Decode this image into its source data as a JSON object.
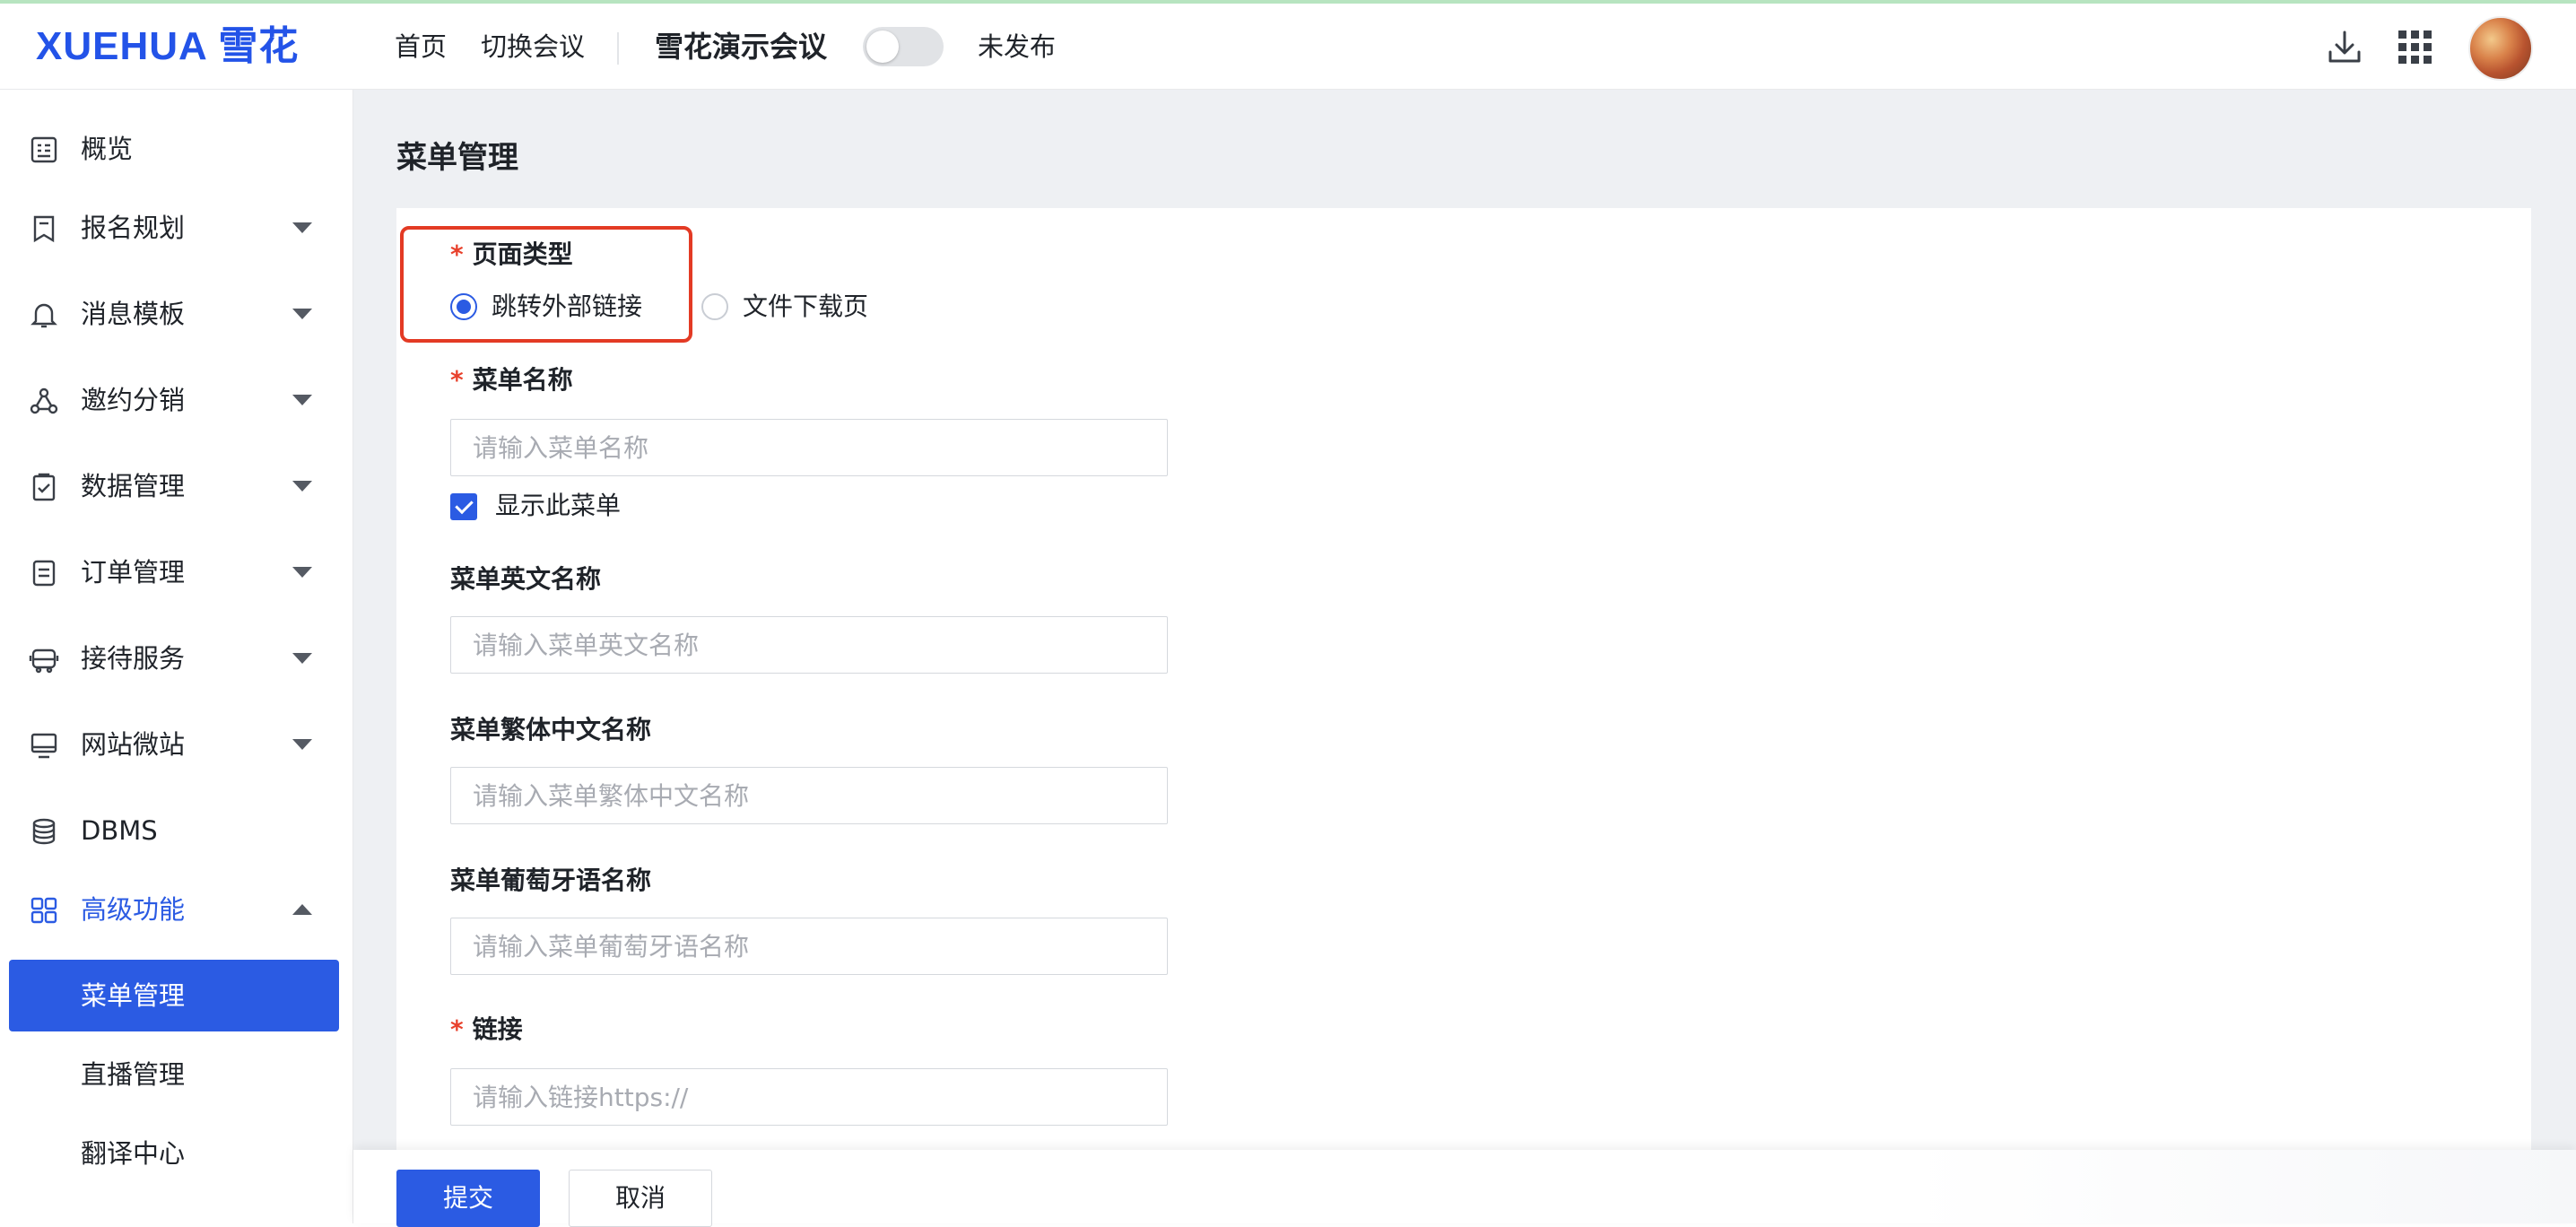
{
  "header": {
    "logo_text": "XUEHUA 雪花",
    "nav": [
      {
        "label": "首页"
      },
      {
        "label": "切换会议"
      }
    ],
    "conference_title": "雪花演示会议",
    "publish_toggle_on": false,
    "publish_status": "未发布",
    "icons": [
      "download-icon",
      "apps-grid-icon"
    ],
    "brand_color": "#2353e8"
  },
  "sidebar": {
    "items": [
      {
        "label": "概览",
        "icon": "overview-icon"
      },
      {
        "label": "报名规划",
        "icon": "bookmark-icon"
      },
      {
        "label": "消息模板",
        "icon": "bell-icon"
      },
      {
        "label": "邀约分销",
        "icon": "share-network-icon"
      },
      {
        "label": "数据管理",
        "icon": "clipboard-check-icon"
      },
      {
        "label": "订单管理",
        "icon": "order-icon"
      },
      {
        "label": "接待服务",
        "icon": "bus-icon"
      },
      {
        "label": "网站微站",
        "icon": "monitor-icon"
      },
      {
        "label": "DBMS",
        "icon": "database-icon"
      },
      {
        "label": "高级功能",
        "icon": "grid-icon"
      }
    ],
    "sub_items": [
      {
        "label": "菜单管理"
      },
      {
        "label": "直播管理"
      },
      {
        "label": "翻译中心"
      }
    ],
    "active_color": "#2b5be3"
  },
  "main": {
    "page_title": "菜单管理",
    "form": {
      "page_type": {
        "label": "页面类型",
        "options": [
          {
            "label": "跳转外部链接",
            "checked": true
          },
          {
            "label": "文件下载页",
            "checked": false
          }
        ]
      },
      "menu_name": {
        "label": "菜单名称",
        "placeholder": "请输入菜单名称"
      },
      "show_menu": {
        "label": "显示此菜单",
        "checked": true
      },
      "menu_name_en": {
        "label": "菜单英文名称",
        "placeholder": "请输入菜单英文名称"
      },
      "menu_name_tc": {
        "label": "菜单繁体中文名称",
        "placeholder": "请输入菜单繁体中文名称"
      },
      "menu_name_pt": {
        "label": "菜单葡萄牙语名称",
        "placeholder": "请输入菜单葡萄牙语名称"
      },
      "link": {
        "label": "链接",
        "placeholder": "请输入链接https://"
      },
      "required_mark": "*"
    },
    "actions": {
      "submit_label": "提交",
      "cancel_label": "取消"
    },
    "highlight_color": "#e33a24"
  }
}
